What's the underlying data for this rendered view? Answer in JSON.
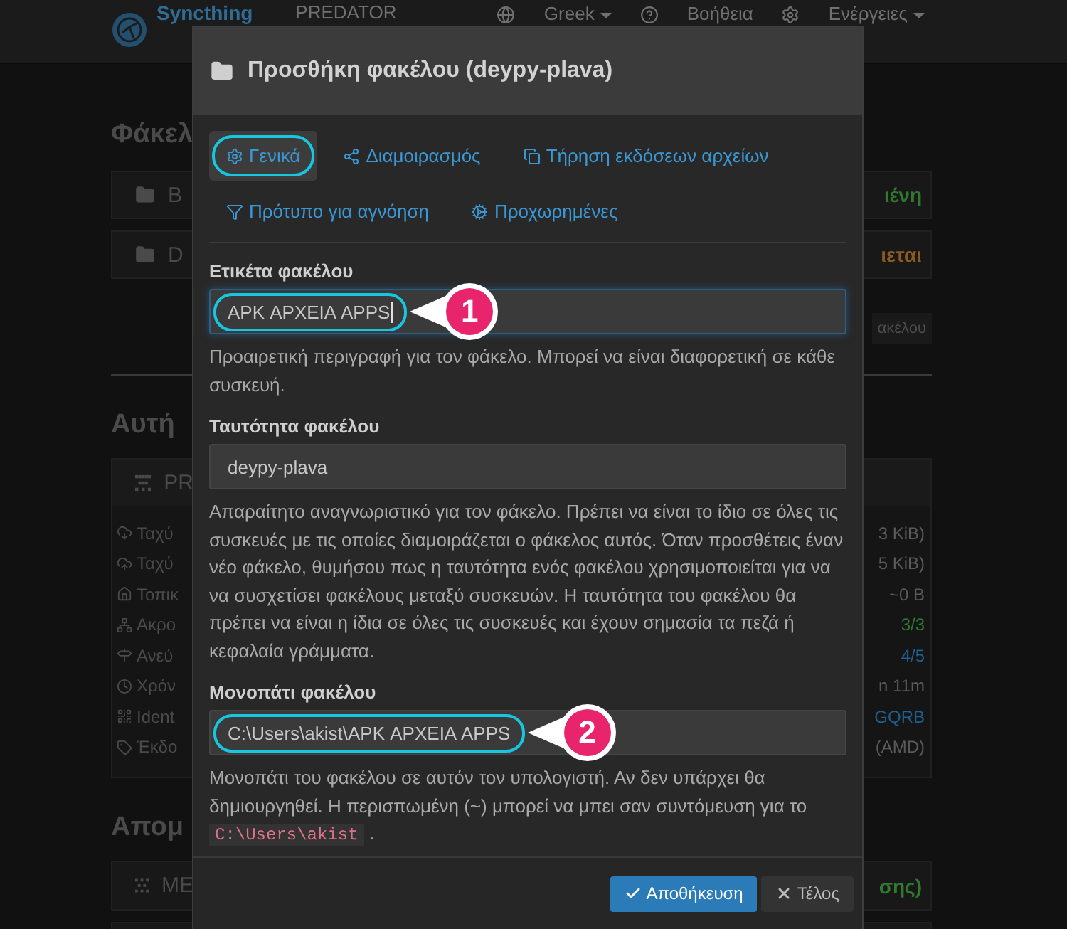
{
  "navbar": {
    "brand": "Syncthing",
    "device": "PREDATOR",
    "menu": [
      {
        "label": "Greek",
        "dropdown": true
      },
      {
        "label": "Βοήθεια",
        "dropdown": false
      },
      {
        "label": "Ενέργειες",
        "dropdown": true
      }
    ]
  },
  "background": [
    {
      "kind": "heading",
      "left": "Φάκελ"
    },
    {
      "kind": "folder",
      "left": "Β",
      "right": "ιένη",
      "color": "#2f7a2f"
    },
    {
      "kind": "folder",
      "left": "D",
      "right": "ιεται",
      "color": "#8a5a1f"
    },
    {
      "kind": "button",
      "right": "ακέλου"
    },
    {
      "kind": "rule"
    },
    {
      "kind": "heading",
      "left": "Αυτή"
    },
    {
      "kind": "device",
      "left": "PR",
      "stats": [
        {
          "left": "Ταχύ",
          "right": "3 KiB)",
          "color": "#5a5a5a"
        },
        {
          "left": "Ταχύ",
          "right": "5 KiB)",
          "color": "#5a5a5a"
        },
        {
          "left": "Τοπικ",
          "right": "~0 B",
          "color": "#5a5a5a"
        },
        {
          "left": "Ακρο",
          "right": "3/3",
          "color": "#2f7a2f"
        },
        {
          "left": "Ανεύ",
          "right": "4/5",
          "color": "#1f5f8f"
        },
        {
          "left": "Χρόν",
          "right": "n 11m",
          "color": "#5a5a5a"
        },
        {
          "left": "Ident",
          "right": "GQRB",
          "color": "#1f5f8f"
        },
        {
          "left": "Έκδο",
          "right": "(AMD)",
          "color": "#5a5a5a"
        }
      ]
    },
    {
      "kind": "heading",
      "left": "Απομ"
    },
    {
      "kind": "remote",
      "left": "ME",
      "right": "σης)",
      "color": "#2f7a2f"
    },
    {
      "kind": "stub"
    }
  ],
  "dialog": {
    "title": "Προσθήκη φακέλου (deypy-plava)",
    "tabs": [
      {
        "label": "Γενικά",
        "selected": true,
        "highlighted": true
      },
      {
        "label": "Διαμοιρασμός",
        "selected": false,
        "highlighted": false
      },
      {
        "label": "Τήρηση εκδόσεων αρχείων",
        "selected": false,
        "highlighted": false
      },
      {
        "label": "Πρότυπο για αγνόηση",
        "selected": false,
        "highlighted": false
      },
      {
        "label": "Προχωρημένες",
        "selected": false,
        "highlighted": false
      }
    ],
    "fields": [
      {
        "label": "Ετικέτα φακέλου",
        "value": "APK ΑΡΧΕΙΑ APPS",
        "focused": true,
        "highlighted": true,
        "callout": "1",
        "help": "Προαιρετική περιγραφή για τον φάκελο. Μπορεί να είναι διαφορετική σε κάθε συσκευή."
      },
      {
        "label": "Ταυτότητα φακέλου",
        "value": "deypy-plava",
        "focused": false,
        "highlighted": false,
        "help": "Απαραίτητο αναγνωριστικό για τον φάκελο. Πρέπει να είναι το ίδιο σε όλες τις συσκευές με τις οποίες διαμοιράζεται ο φάκελος αυτός. Όταν προσθέτεις έναν νέο φάκελο, θυμήσου πως η ταυτότητα ενός φακέλου χρησιμοποιείται για να να συσχετίσει φακέλους μεταξύ συσκευών. Η ταυτότητα του φακέλου θα πρέπει να είναι η ίδια σε όλες τις συσκευές και έχουν σημασία τα πεζά ή κεφαλαία γράμματα."
      },
      {
        "label": "Μονοπάτι φακέλου",
        "value": "C:\\Users\\akist\\APK ΑΡΧΕΙΑ APPS",
        "focused": false,
        "highlighted": true,
        "callout": "2",
        "help": "Μονοπάτι του φακέλου σε αυτόν τον υπολογιστή. Αν δεν υπάρχει θα δημιουργηθεί. Η περισπωμένη (~) μπορεί να μπει σαν συντόμευση για το",
        "code": "C:\\Users\\akist",
        "help_end": "."
      }
    ],
    "buttons": [
      {
        "label": "Αποθήκευση",
        "kind": "primary"
      },
      {
        "label": "Τέλος",
        "kind": "close"
      }
    ]
  }
}
